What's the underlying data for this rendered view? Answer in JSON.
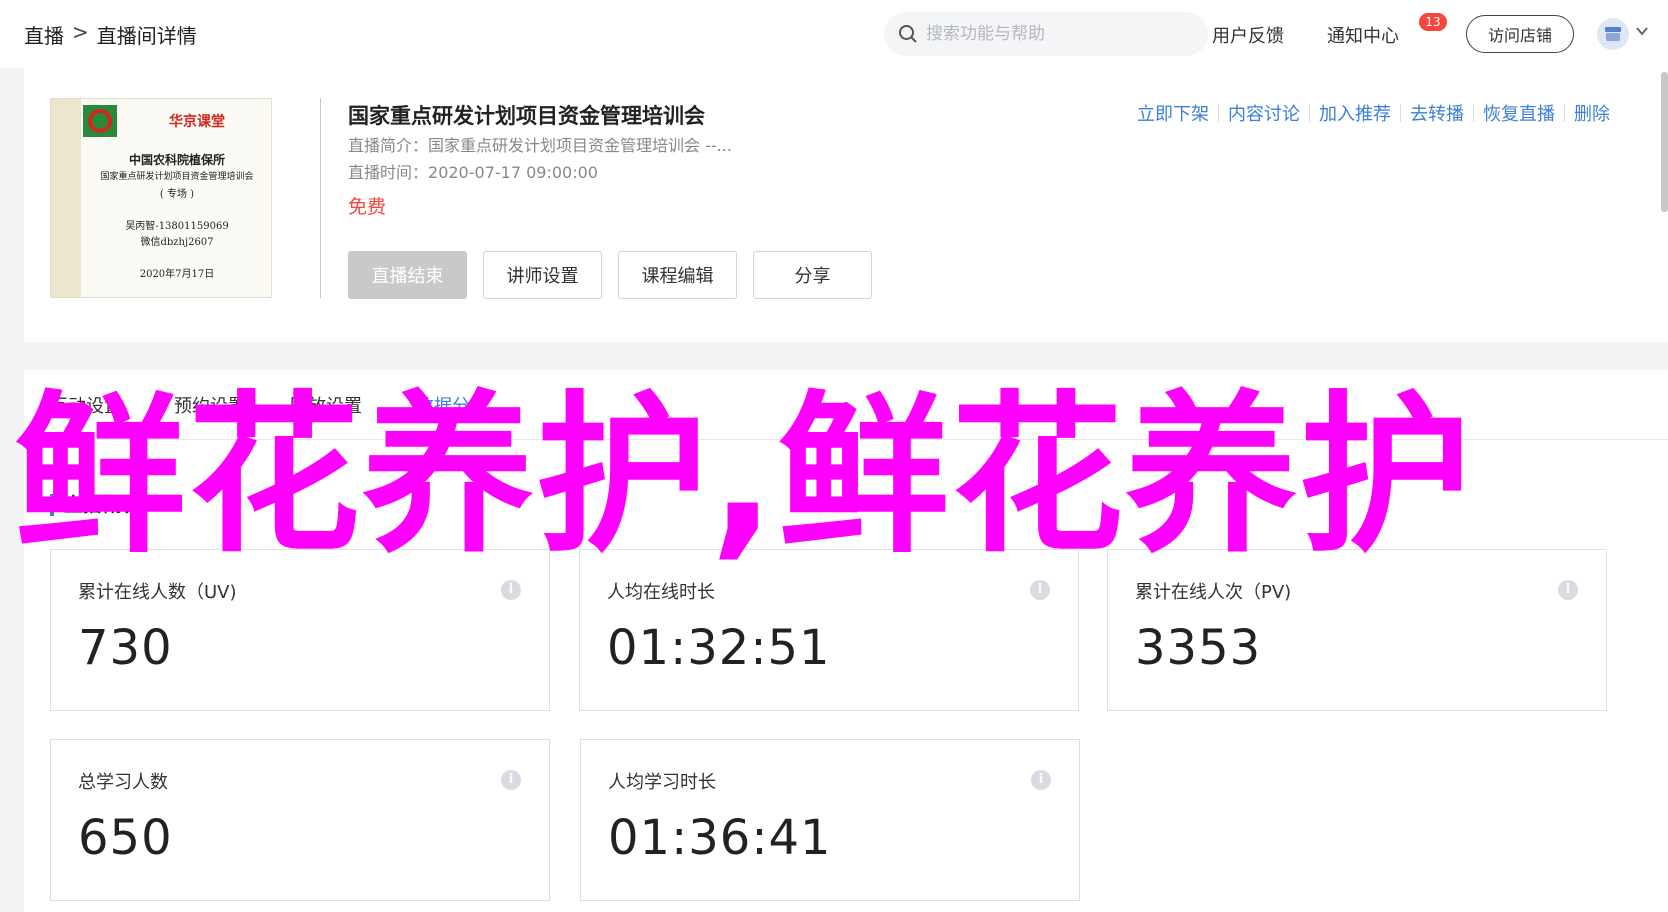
{
  "header": {
    "breadcrumb": [
      "直播",
      "直播间详情"
    ],
    "breadcrumb_sep": ">",
    "search_placeholder": "搜索功能与帮助",
    "feedback_label": "用户反馈",
    "notification_label": "通知中心",
    "notification_count": "13",
    "visit_store_label": "访问店铺"
  },
  "live": {
    "cover": {
      "brand": "华京课堂",
      "org": "中国农科院植保所",
      "course": "国家重点研发计划项目资金管理培训会",
      "tag": "( 专场 )",
      "contact": "吴丙智-13801159069",
      "wechat": "微信dbzhj2607",
      "date": "2020年7月17日"
    },
    "title": "国家重点研发计划项目资金管理培训会",
    "intro_label": "直播简介：",
    "intro": "国家重点研发计划项目资金管理培训会 --...",
    "time_label": "直播时间：",
    "time": "2020-07-17 09:00:00",
    "price": "免费",
    "buttons": [
      "直播结束",
      "讲师设置",
      "课程编辑",
      "分享"
    ],
    "actions": [
      "立即下架",
      "内容讨论",
      "加入推荐",
      "去转播",
      "恢复直播",
      "删除"
    ]
  },
  "tabs": [
    "互动设置",
    "预约设置",
    "回放设置",
    "数据分析"
  ],
  "section_title": "直播概况",
  "stats": [
    {
      "label": "累计在线人数（UV)",
      "value": "730"
    },
    {
      "label": "人均在线时长",
      "value": "01:32:51"
    },
    {
      "label": "累计在线人次（PV)",
      "value": "3353"
    },
    {
      "label": "总学习人数",
      "value": "650"
    },
    {
      "label": "人均学习时长",
      "value": "01:36:41"
    }
  ],
  "watermark": "鲜花养护,鲜花养护",
  "colors": {
    "accent": "#3d7fd9",
    "price": "#f5463f",
    "watermark": "#ff00ff",
    "badge": "#f5463f"
  }
}
